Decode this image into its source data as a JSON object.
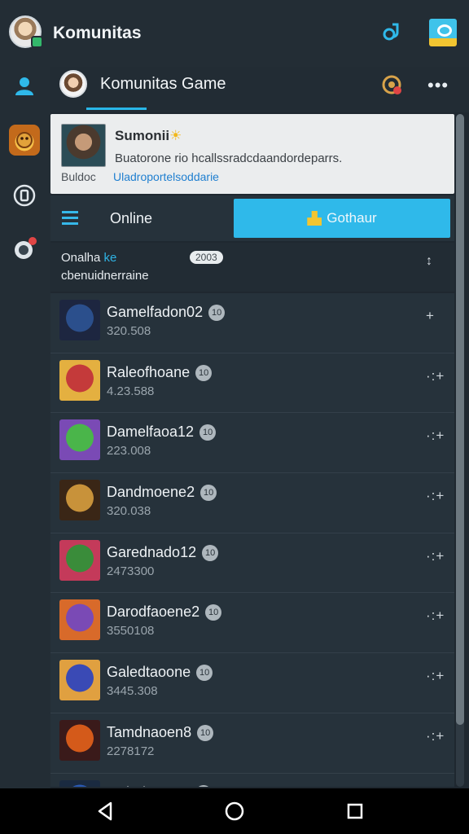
{
  "app": {
    "title": "Komunitas"
  },
  "top_icons": [
    "link-icon",
    "card-icon"
  ],
  "rail": {
    "items": [
      "profile-icon",
      "game-icon",
      "clipboard-icon",
      "chat-icon"
    ]
  },
  "community": {
    "title": "Komunitas Game",
    "more": "•••"
  },
  "feature": {
    "title": "Sumonii",
    "sun": "☀",
    "description": "Buatorone rio hcallssradcdaandordeparrs.",
    "sub": "Buldoc",
    "link": "Uladroportelsoddarie"
  },
  "online": {
    "label": "Online",
    "join_label": "Gothaur"
  },
  "list_header": {
    "line1_prefix": "Onalha",
    "line1_highlight": "ke",
    "line2": "cbenuidnerraine",
    "pill": "2003"
  },
  "colors": {
    "accent": "#2fb9ea",
    "background": "#1f2830",
    "card": "#ebedee",
    "badge": "#f2c531"
  },
  "rows": [
    {
      "name": "Gamelfadon02",
      "badge": "10",
      "count": "320.508",
      "action": "+",
      "icon_colors": [
        "#2b4f8c",
        "#1d2640"
      ]
    },
    {
      "name": "Raleofhoane",
      "badge": "10",
      "count": "4.23.588",
      "action": "·:+",
      "icon_colors": [
        "#c43a3a",
        "#e4b040"
      ]
    },
    {
      "name": "Damelfaoa12",
      "badge": "10",
      "count": "223.008",
      "action": "·:+",
      "icon_colors": [
        "#4ab54a",
        "#7a4ab5"
      ]
    },
    {
      "name": "Dandmoene2",
      "badge": "10",
      "count": "320.038",
      "action": "·:+",
      "icon_colors": [
        "#c8923a",
        "#3a2616"
      ]
    },
    {
      "name": "Garednado12",
      "badge": "10",
      "count": "2473300",
      "action": "·:+",
      "icon_colors": [
        "#3a8c3a",
        "#c43a5a"
      ]
    },
    {
      "name": "Darodfaoene2",
      "badge": "10",
      "count": "3550108",
      "action": "·:+",
      "icon_colors": [
        "#7a4ab5",
        "#d86a2a"
      ]
    },
    {
      "name": "Galedtaoone",
      "badge": "10",
      "count": "3445.308",
      "action": "·:+",
      "icon_colors": [
        "#3a4ab5",
        "#e0a040"
      ]
    },
    {
      "name": "Tamdnaoen8",
      "badge": "10",
      "count": "2278172",
      "action": "·:+",
      "icon_colors": [
        "#d45a1a",
        "#3a1a1a"
      ]
    },
    {
      "name": "Galedtacone",
      "badge": "10",
      "count": "",
      "action": "",
      "icon_colors": [
        "#2a5ab5",
        "#1a2a40"
      ]
    }
  ],
  "navbar": {
    "buttons": [
      "back-icon",
      "home-icon",
      "recent-apps-icon"
    ]
  }
}
